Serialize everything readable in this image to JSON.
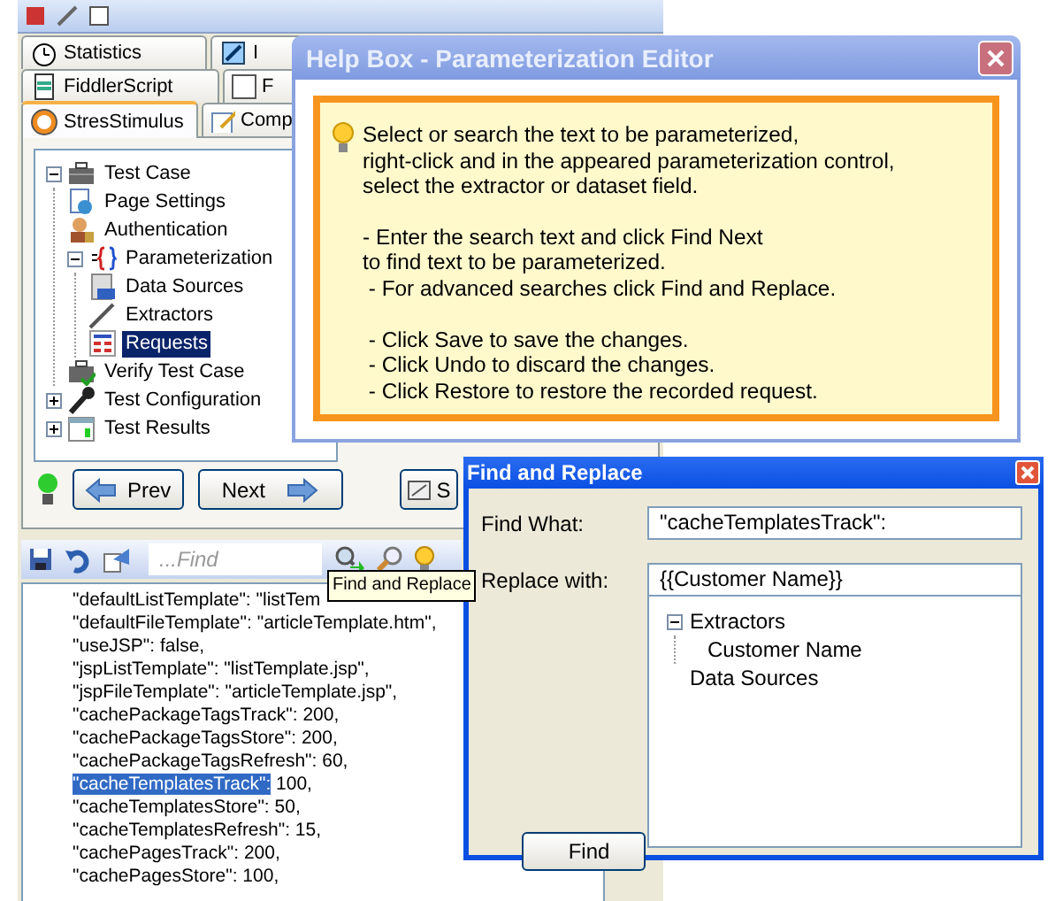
{
  "main_panel": {
    "tab_rows": [
      {
        "tabs": [
          {
            "label": "Statistics",
            "selected": false
          },
          {
            "label": "I",
            "selected": false
          }
        ]
      },
      {
        "tabs": [
          {
            "label": "FiddlerScript",
            "selected": false
          },
          {
            "label": "F",
            "selected": false
          }
        ]
      },
      {
        "tabs": [
          {
            "label": "StresStimulus",
            "selected": true
          },
          {
            "label": "Comp",
            "selected": false
          }
        ]
      }
    ],
    "tree": [
      {
        "label": "Test Case",
        "selected": false,
        "expanded": true,
        "children": [
          {
            "label": "Page Settings",
            "selected": false
          },
          {
            "label": "Authentication",
            "selected": false
          },
          {
            "label": "Parameterization",
            "selected": false,
            "expanded": true,
            "children": [
              {
                "label": "Data Sources",
                "selected": false
              },
              {
                "label": "Extractors",
                "selected": false
              },
              {
                "label": "Requests",
                "selected": true
              }
            ]
          },
          {
            "label": "Verify Test Case",
            "selected": false
          }
        ]
      },
      {
        "label": "Test Configuration",
        "selected": false,
        "expanded": false
      },
      {
        "label": "Test Results",
        "selected": false,
        "expanded": false
      }
    ],
    "nav_buttons": [
      {
        "kind": "prev",
        "label": "Prev"
      },
      {
        "kind": "next",
        "label": "Next"
      },
      {
        "kind": "other",
        "label": "S"
      }
    ],
    "find_field": {
      "placeholder": "...Find"
    },
    "tooltip": "Find and Replace",
    "code_lines": [
      {
        "text": "\"defaultListTemplate\": \"listTem"
      },
      {
        "text": "\"defaultFileTemplate\": \"articleTemplate.htm\","
      },
      {
        "text": "\"useJSP\": false,"
      },
      {
        "text": "\"jspListTemplate\": \"listTemplate.jsp\","
      },
      {
        "text": "\"jspFileTemplate\": \"articleTemplate.jsp\","
      },
      {
        "text": "\"cachePackageTagsTrack\": 200,"
      },
      {
        "text": "\"cachePackageTagsStore\": 200,"
      },
      {
        "text": "\"cachePackageTagsRefresh\": 60,"
      },
      {
        "highlight": "\"cacheTemplatesTrack\":",
        "text": " 100,"
      },
      {
        "text": "\"cacheTemplatesStore\": 50,"
      },
      {
        "text": "\"cacheTemplatesRefresh\": 15,"
      },
      {
        "text": "\"cachePagesTrack\": 200,"
      },
      {
        "text": "\"cachePagesStore\": 100,"
      }
    ]
  },
  "help_box": {
    "title": "Help Box - Parameterization Editor",
    "paragraphs": [
      "Select or search the text to be parameterized,\nright-click and in the appeared parameterization control,\nselect the extractor or dataset field.",
      "- Enter the search text and click Find Next\nto find text to be parameterized.\n - For advanced searches click Find and Replace.",
      " - Click Save to save the changes.\n - Click Undo to discard the changes.\n - Click Restore to restore the recorded request."
    ]
  },
  "find_dialog": {
    "title": "Find and Replace",
    "find_what": {
      "label": "Find What:",
      "value": "\"cacheTemplatesTrack\":"
    },
    "replace_with": {
      "label": "Replace with:",
      "value": "{{Customer Name}}"
    },
    "tree": [
      {
        "label": "Extractors",
        "expanded": true,
        "children": [
          {
            "label": "Customer Name"
          }
        ]
      },
      {
        "label": "Data Sources"
      }
    ],
    "find_button": "Find"
  }
}
